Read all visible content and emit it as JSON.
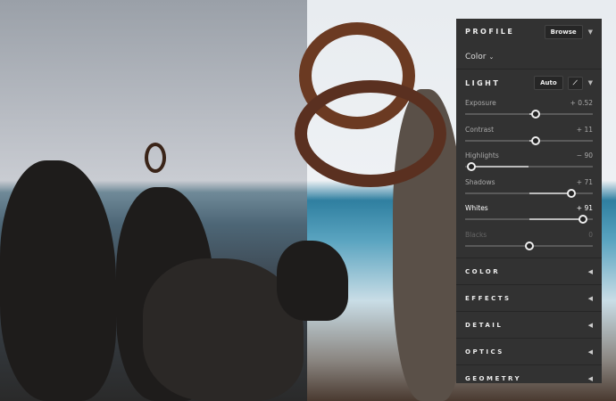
{
  "profile": {
    "title": "PROFILE",
    "browse_label": "Browse",
    "selected": "Color"
  },
  "light": {
    "title": "LIGHT",
    "auto_label": "Auto",
    "sliders": [
      {
        "label": "Exposure",
        "value": "+ 0.52",
        "fraction": 0.55
      },
      {
        "label": "Contrast",
        "value": "+ 11",
        "fraction": 0.55
      },
      {
        "label": "Highlights",
        "value": "− 90",
        "fraction": 0.05
      },
      {
        "label": "Shadows",
        "value": "+ 71",
        "fraction": 0.83
      },
      {
        "label": "Whites",
        "value": "+ 91",
        "fraction": 0.92
      },
      {
        "label": "Blacks",
        "value": "0",
        "fraction": 0.5
      }
    ]
  },
  "sections": [
    "COLOR",
    "EFFECTS",
    "DETAIL",
    "OPTICS",
    "GEOMETRY"
  ]
}
